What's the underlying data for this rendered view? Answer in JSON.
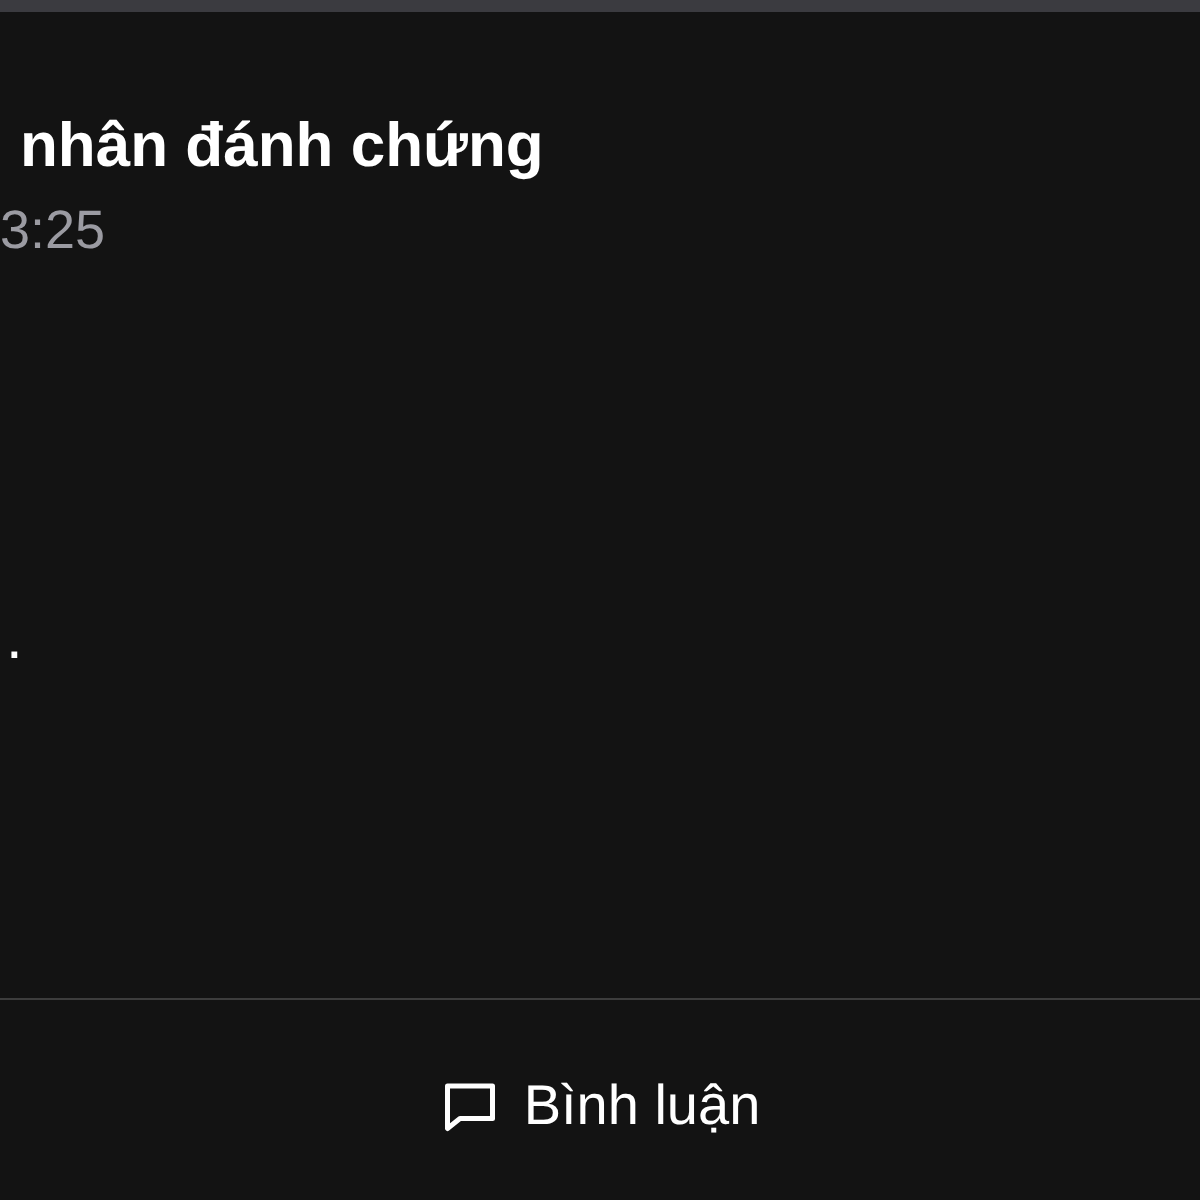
{
  "post": {
    "title": "nhân đánh chứng",
    "time": "3:25",
    "body_end": "."
  },
  "actions": [
    {
      "kind": "comment",
      "label": "Bình luận"
    }
  ]
}
